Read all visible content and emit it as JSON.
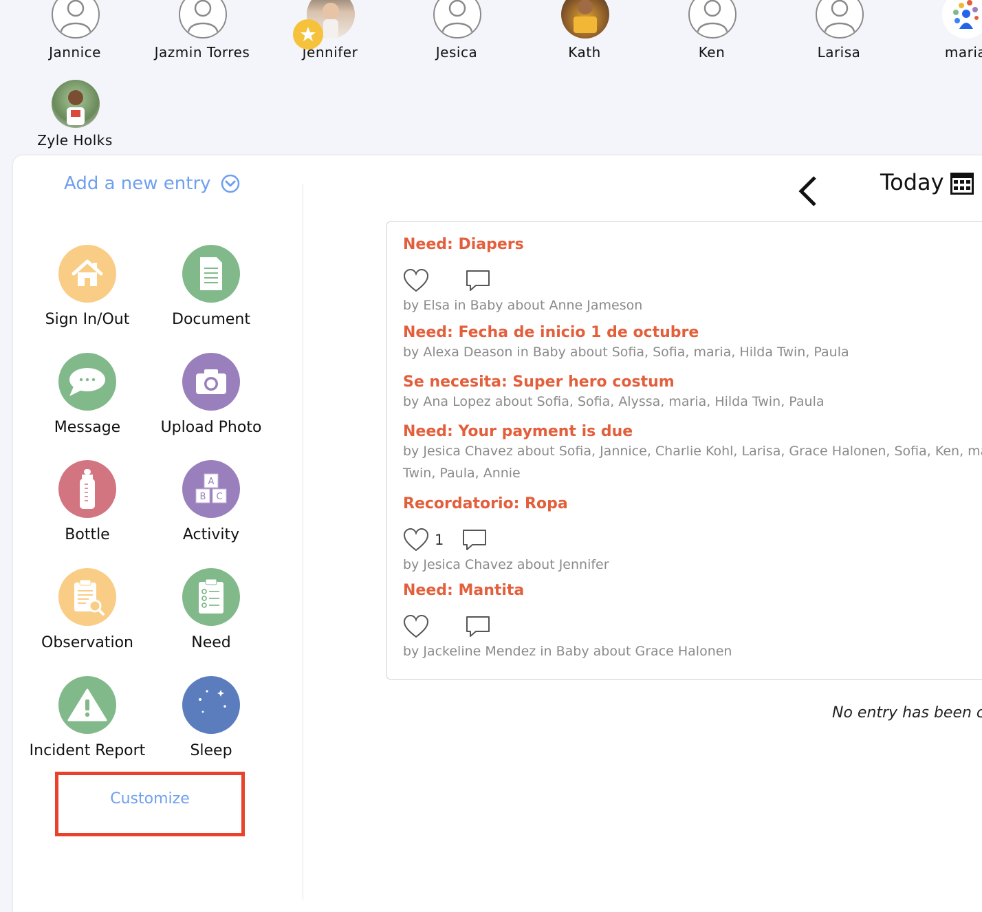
{
  "children": [
    {
      "name": "Jannice",
      "avatar": "default-user-icon"
    },
    {
      "name": "Jazmin Torres",
      "avatar": "default-user-icon"
    },
    {
      "name": "Jennifer",
      "avatar": "photo",
      "badge": "star-badge-icon"
    },
    {
      "name": "Jesica",
      "avatar": "default-user-icon"
    },
    {
      "name": "Kath",
      "avatar": "photo"
    },
    {
      "name": "Ken",
      "avatar": "default-user-icon"
    },
    {
      "name": "Larisa",
      "avatar": "default-user-icon"
    },
    {
      "name": "maria",
      "avatar": "colorful-logo-icon"
    },
    {
      "name": "Zyle Holks",
      "avatar": "photo"
    }
  ],
  "sidebar": {
    "add_entry_label": "Add a new entry",
    "entry_types": [
      {
        "label": "Sign In/Out",
        "icon": "house-icon",
        "color": "#f9cd86"
      },
      {
        "label": "Document",
        "icon": "document-icon",
        "color": "#82b98b"
      },
      {
        "label": "Message",
        "icon": "chat-bubble-icon",
        "color": "#82b98b"
      },
      {
        "label": "Upload Photo",
        "icon": "camera-icon",
        "color": "#9a7fbd"
      },
      {
        "label": "Bottle",
        "icon": "bottle-icon",
        "color": "#d27580"
      },
      {
        "label": "Activity",
        "icon": "abc-blocks-icon",
        "color": "#9a7fbd"
      },
      {
        "label": "Observation",
        "icon": "magnifier-clipboard-icon",
        "color": "#f9cd86"
      },
      {
        "label": "Need",
        "icon": "checklist-icon",
        "color": "#82b98b"
      },
      {
        "label": "Incident Report",
        "icon": "warning-icon",
        "color": "#82b98b"
      },
      {
        "label": "Sleep",
        "icon": "moon-stars-icon",
        "color": "#5b7dbe"
      }
    ],
    "customize_label": "Customize"
  },
  "header": {
    "date_label": "Today"
  },
  "feed": [
    {
      "title": "Need: Diapers",
      "meta": "by Elsa in Baby about Anne Jameson",
      "reactions": true,
      "likes": ""
    },
    {
      "title": "Need: Fecha de inicio 1 de octubre",
      "meta": "by Alexa Deason in Baby about Sofia, Sofia, maria, Hilda Twin, Paula",
      "reactions": false
    },
    {
      "title": "Se necesita: Super hero costum",
      "meta": "by Ana Lopez about Sofia, Sofia, Alyssa, maria, Hilda Twin, Paula",
      "reactions": false
    },
    {
      "title": "Need: Your payment is due",
      "meta": "by Jesica Chavez about Sofia, Jannice, Charlie Kohl, Larisa, Grace Halonen, Sofia, Ken, ma",
      "meta2": "Twin, Paula, Annie",
      "reactions": false
    },
    {
      "title": "Recordatorio: Ropa",
      "meta": "by Jesica Chavez about Jennifer",
      "reactions": true,
      "likes": "1"
    },
    {
      "title": "Need: Mantita",
      "meta": "by Jackeline Mendez in Baby about Grace Halonen",
      "reactions": true,
      "likes": ""
    }
  ],
  "empty_message": "No entry has been cr"
}
